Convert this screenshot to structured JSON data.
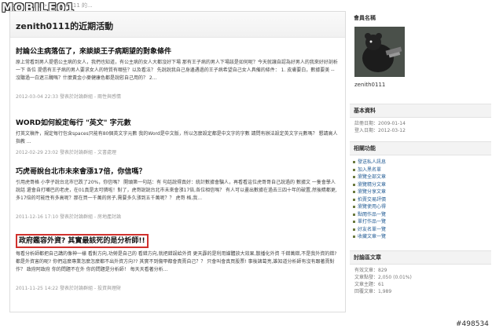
{
  "site": {
    "logo_text": "MOBILE01",
    "crumb": "Mobile01 首頁 > zenith0111 的..."
  },
  "page": {
    "title": "zenith0111的近期活動"
  },
  "posts": [
    {
      "title": "討論公主病落伍了，來談談王子病期望的對象條件",
      "body": "原上常看到男人提倡公主病的女人，我們也知道，有公主病的女人大都沒好下場 那有王子病的男人下場該是如何呢？今天就讓自認為好男人的我來好好剖析一下 各位 提倡有王子病的男人要求女人的特質有哪些？以及看法？ 先說說我自己身邊遇過的王子病希望自己女人具備的條件： 1. 皮膚要白，數據要美 -- 沒聽過一白遮三醜嗎？什麼黃金小麥健康色都是說慰自己用的？ 2...",
      "meta": "2012-03-04 22:33 發表於討論群組 - 兩性與感情"
    },
    {
      "title": "WORD如何設定每行 \"英文\" 字元數",
      "body": "打英文稿件，規定每行包含spaces只能有80個英文字元數 我的Word是中文版，所以怎麼設定都是中文字的字數 請問有辦法設定英文字元數嗎？ 懇請高人指教 ...",
      "meta": "2012-02-29 23:02 發表於討論群組 - 文書處理"
    },
    {
      "title": "巧虎哥說台北市未來會漲17倍，你信嗎？",
      "body": "引用虎哥格 小李子說台北市已跌了20%，你信嗎？ 開頭第一句話：有 句話說得真好：統計數據會騙人，再看看這位虎哥哥自己說過的 數據文 一隻會學人說話 還會自打嘴巴的老虎，在01真是太可憐啦！對了，虎哥說說台北市未來會漲17倍,各位相信嗎？ 有人可以畫出數據在過去三四十年的破置,然後睛都更,多17倍的可能性有多高呢？那在買一千萬的房子,需要多久漲到五千萬呢？？ 虎哥 格,我...",
      "meta": "2011-12-16 17:10 發表於討論群組 - 房地產討論"
    },
    {
      "title": "政府鑑容外資? 其實最該死的是分析師!!",
      "body": "每看分析師都把自己講的像神一樣 看對方向,功勞是自己的 看錯方向,就把錯誤給外資 更天霹的是利用媒體放大效果,散播化外資 千錯萬錯,不是我外資的錯? 都是外資害的呢? 你們這麼專業怎麼怎麼都不出外資方向?? 其實不到傷甲都會責賣自己？？ 只會叫會真買股票! 事後諸葛亮,誰知道分析師有沒有跟著賣對作？ 政府阿政府 你的問題不在外 你的問題是分析師！ 每天天看著分析...",
      "meta": "2011-11-25 14:22 發表於討論群組 - 投資與理財"
    }
  ],
  "sidebar": {
    "member_title": "會員名稱",
    "username": "zenith0111",
    "basic_title": "基本資料",
    "basic": [
      {
        "k": "註冊日期：",
        "v": "2009-01-14"
      },
      {
        "k": "登入日期：",
        "v": "2012-03-12"
      }
    ],
    "func_title": "相關功能",
    "links": [
      "發送私人訊息",
      "加入黑名單",
      "瀏覽全部文章",
      "瀏覽精分文章",
      "瀏覽分享文章",
      "拍賣交易評價",
      "瀏覽使用心得",
      "點閱作品一覽",
      "單打作品一覽",
      "好友名單一覽",
      "收藏文章一覽"
    ],
    "stats_title": "討論區文章",
    "stats": [
      {
        "k": "有效文章：",
        "v": "829"
      },
      {
        "k": "文章點發：",
        "v": "2,050 (0.01%)"
      },
      {
        "k": "文章主題：",
        "v": "61"
      },
      {
        "k": "回覆文章：",
        "v": "1,989"
      }
    ]
  },
  "watermark": "#498534"
}
